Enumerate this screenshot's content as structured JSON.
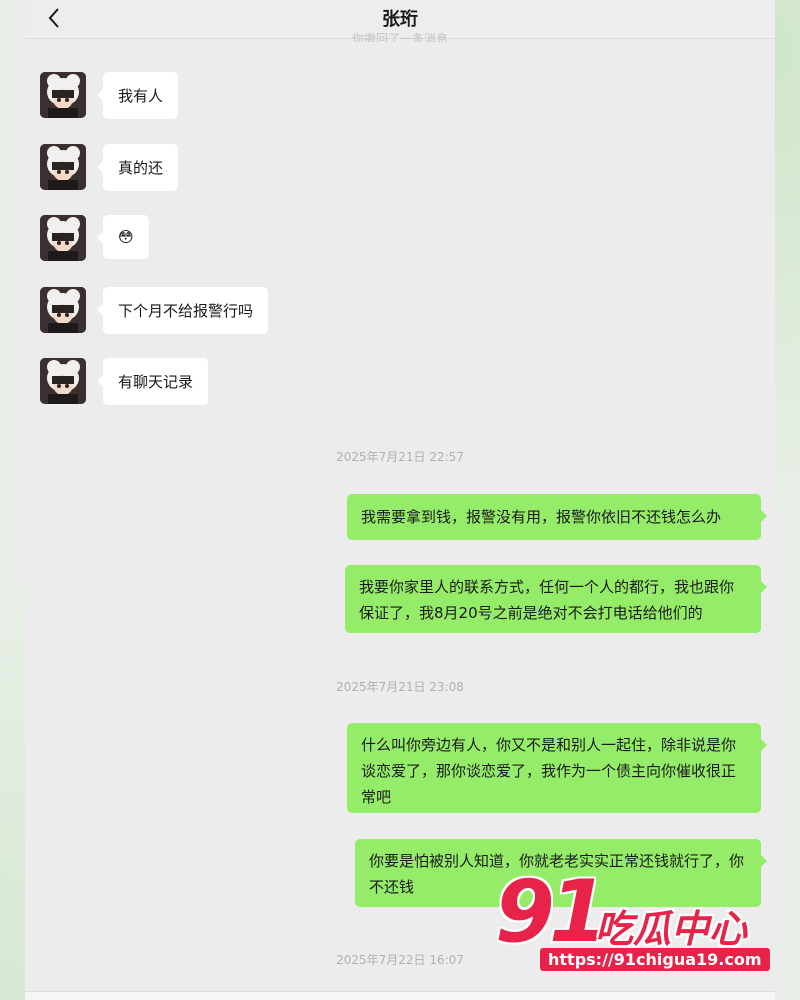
{
  "header": {
    "contact_name": "张珩",
    "ghost_text": "你撤回了一条消息"
  },
  "incoming_messages": [
    {
      "text": "我有人"
    },
    {
      "text": "真的还"
    },
    {
      "text": "😳"
    },
    {
      "text": "下个月不给报警行吗"
    },
    {
      "text": "有聊天记录"
    }
  ],
  "timestamps": [
    "2025年7月21日 22:57",
    "2025年7月21日 23:08",
    "2025年7月22日 16:07"
  ],
  "outgoing_messages": [
    {
      "text": "我需要拿到钱，报警没有用，报警你依旧不还钱怎么办"
    },
    {
      "text": "我要你家里人的联系方式，任何一个人的都行，我也跟你保证了，我8月20号之前是绝对不会打电话给他们的"
    },
    {
      "text": "什么叫你旁边有人，你又不是和别人一起住，除非说是你谈恋爱了，那你谈恋爱了，我作为一个债主向你催收很正常吧"
    },
    {
      "text": "你要是怕被别人知道，你就老老实实正常还钱就行了，你不还钱"
    }
  ],
  "watermark": {
    "number": "91",
    "brand": "吃瓜中心",
    "url": "https://91chigua19.com"
  },
  "colors": {
    "outgoing_bubble": "#95ec69",
    "incoming_bubble": "#ffffff",
    "chat_bg": "#ececec",
    "watermark": "#e8234a"
  }
}
